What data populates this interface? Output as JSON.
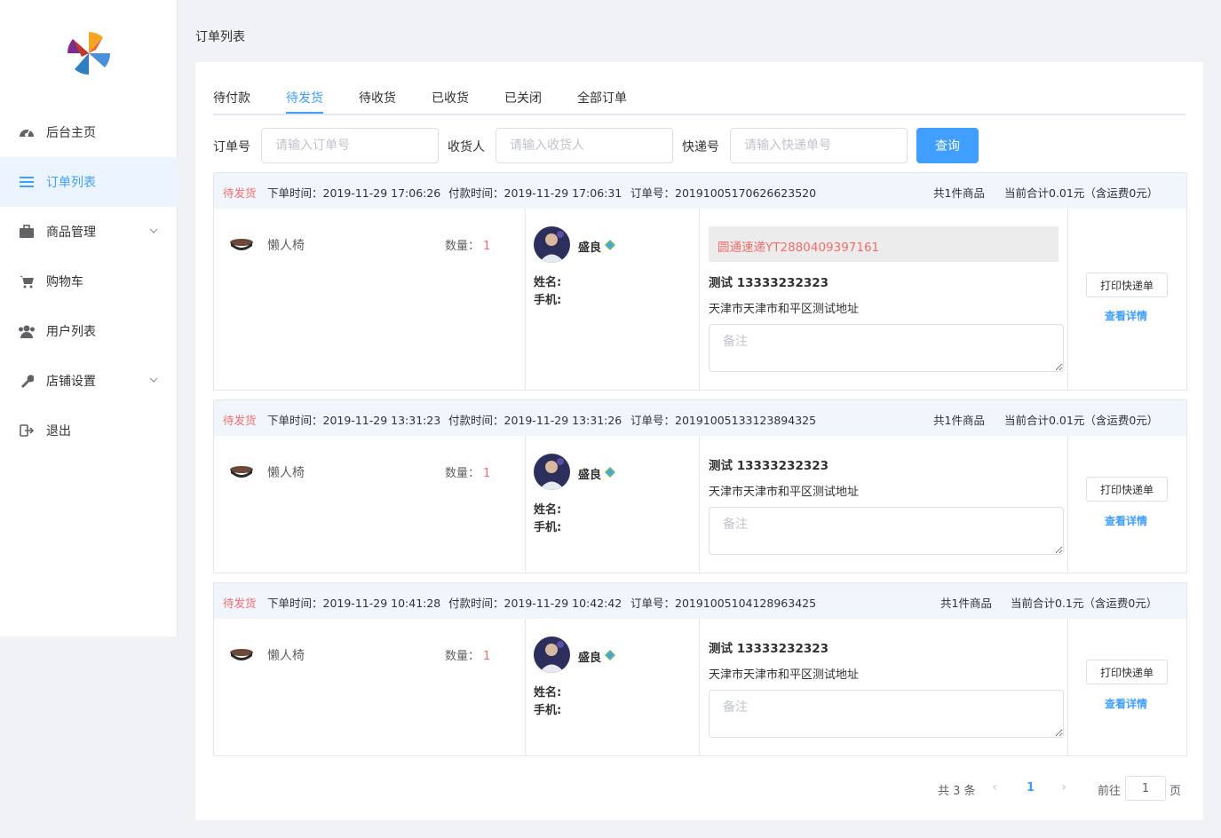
{
  "sidebar": {
    "items": [
      {
        "label": "后台主页",
        "icon": "dashboard-icon"
      },
      {
        "label": "订单列表",
        "icon": "list-icon",
        "active": true
      },
      {
        "label": "商品管理",
        "icon": "briefcase-icon",
        "expandable": true
      },
      {
        "label": "购物车",
        "icon": "cart-icon"
      },
      {
        "label": "用户列表",
        "icon": "users-icon"
      },
      {
        "label": "店铺设置",
        "icon": "wrench-icon",
        "expandable": true
      },
      {
        "label": "退出",
        "icon": "logout-icon"
      }
    ]
  },
  "page": {
    "title": "订单列表"
  },
  "tabs": [
    "待付款",
    "待发货",
    "待收货",
    "已收货",
    "已关闭",
    "全部订单"
  ],
  "active_tab": "待发货",
  "filters": {
    "order_no_label": "订单号",
    "order_no_placeholder": "请输入订单号",
    "receiver_label": "收货人",
    "receiver_placeholder": "请输入收货人",
    "express_label": "快递号",
    "express_placeholder": "请输入快递单号",
    "query_button": "查询"
  },
  "orders": [
    {
      "status": "待发货",
      "order_time": "下单时间：2019-11-29 17:06:26",
      "pay_time": "付款时间：2019-11-29 17:06:31",
      "order_no": "订单号：20191005170626623520",
      "item_count": "共1件商品",
      "total": "当前合计0.01元（含运费0元）",
      "product_name": "懒人椅",
      "qty_label": "数量：",
      "qty": "1",
      "buyer_name": "盛良",
      "name_label": "姓名:",
      "phone_label": "手机:",
      "express_info": "圆通速递YT2880409397161",
      "contact": "测试   13333232323",
      "address": "天津市天津市和平区测试地址",
      "remark_placeholder": "备注",
      "print_button": "打印快递单",
      "detail_link": "查看详情"
    },
    {
      "status": "待发货",
      "order_time": "下单时间：2019-11-29 13:31:23",
      "pay_time": "付款时间：2019-11-29 13:31:26",
      "order_no": "订单号：20191005133123894325",
      "item_count": "共1件商品",
      "total": "当前合计0.01元（含运费0元）",
      "product_name": "懒人椅",
      "qty_label": "数量：",
      "qty": "1",
      "buyer_name": "盛良",
      "name_label": "姓名:",
      "phone_label": "手机:",
      "contact": "测试   13333232323",
      "address": "天津市天津市和平区测试地址",
      "remark_placeholder": "备注",
      "print_button": "打印快递单",
      "detail_link": "查看详情"
    },
    {
      "status": "待发货",
      "order_time": "下单时间：2019-11-29 10:41:28",
      "pay_time": "付款时间：2019-11-29 10:42:42",
      "order_no": "订单号：20191005104128963425",
      "item_count": "共1件商品",
      "total": "当前合计0.1元（含运费0元）",
      "product_name": "懒人椅",
      "qty_label": "数量：",
      "qty": "1",
      "buyer_name": "盛良",
      "name_label": "姓名:",
      "phone_label": "手机:",
      "contact": "测试   13333232323",
      "address": "天津市天津市和平区测试地址",
      "remark_placeholder": "备注",
      "print_button": "打印快递单",
      "detail_link": "查看详情"
    }
  ],
  "pagination": {
    "total_text": "共 3 条",
    "current_page": "1",
    "goto_label": "前往",
    "goto_value": "1",
    "page_suffix": "页"
  },
  "colors": {
    "accent": "#409eff",
    "status": "#f56c6c",
    "header_bg": "#f1f6fd"
  }
}
